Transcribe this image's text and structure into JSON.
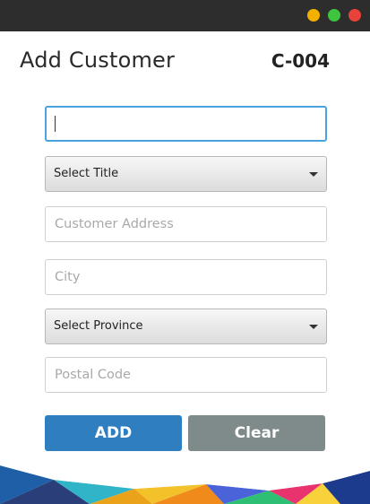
{
  "window": {
    "buttons": {
      "minimize": "minimize",
      "maximize": "maximize",
      "close": "close"
    }
  },
  "header": {
    "title": "Add Customer",
    "customer_id": "C-004"
  },
  "form": {
    "name_field": {
      "value": "",
      "placeholder": ""
    },
    "title_select": {
      "selected": "Select Title"
    },
    "address_field": {
      "value": "",
      "placeholder": "Customer Address"
    },
    "city_field": {
      "value": "",
      "placeholder": "City"
    },
    "province_select": {
      "selected": "Select Province"
    },
    "postal_field": {
      "value": "",
      "placeholder": "Postal Code"
    }
  },
  "actions": {
    "add_label": "ADD",
    "clear_label": "Clear"
  },
  "colors": {
    "titlebar": "#2d2d2d",
    "add_button": "#2f7fc0",
    "clear_button": "#7f8b8b",
    "focus_border": "#4aa3df"
  }
}
